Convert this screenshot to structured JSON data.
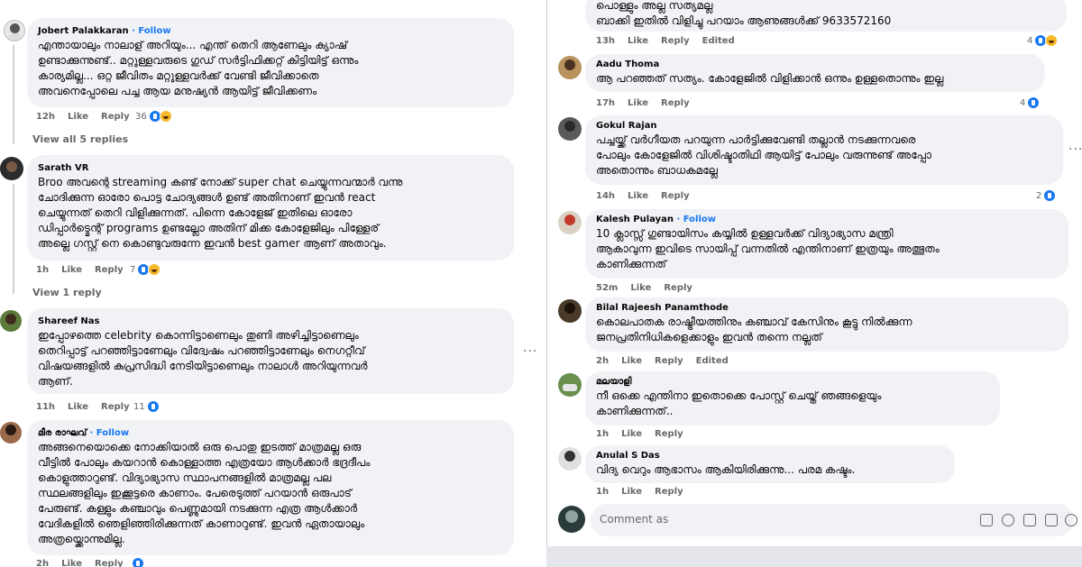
{
  "left": {
    "comments": [
      {
        "name": "Jobert Palakkaran",
        "follow": "· Follow",
        "text": "എന്തായാലും നാലാള് അറിയും... എന്ത് തെറി ആണേലും ക്യാഷ്\nഉണ്ടാക്കുന്നുണ്ട്.. മറ്റുള്ളവരുടെ ഗുഡ് സർട്ടിഫിക്കറ്റ് കിട്ടിയിട്ട് ഒന്നും\nകാര്യമില്ല... ഒറ്റ ജീവിതം മറ്റുള്ളവർക്ക് വേണ്ടി ജീവിക്കാതെ\nഅവനെപ്പോലെ പച്ച ആയ മനുഷ്യൻ ആയിട്ട് ജീവിക്കണം",
        "time": "12h",
        "like": "Like",
        "reply": "Reply",
        "count": "36"
      },
      {
        "name": "Sarath VR",
        "follow": "",
        "text": "Broo അവന്റെ streaming കണ്ട് നോക്ക് super chat ചെയ്യുന്നവന്മാർ വന്നു\nചോദിക്കുന്ന ഓരോ പൊട്ട ചോദ്യങ്ങൾ ഉണ്ട് അതിനാണ് ഇവൻ react\nചെയ്യുന്നത് തെറി വിളിക്കുന്നത്. പിന്നെ കോളേജ് ഇതിലെ ഓരോ\nഡിപ്പാർട്മെന്റ് programs ഉണ്ടല്ലോ അതിന് മിക്ക കോളേജിലും പിള്ളേര്\nഅല്ലെ ഗസ്റ്റ് നെ കൊണ്ടുവരുന്നേ ഇവൻ best gamer ആണ് അതാവും.",
        "time": "1h",
        "like": "Like",
        "reply": "Reply",
        "count": "7"
      },
      {
        "name": "Shareef Nas",
        "follow": "",
        "text": "ഇപ്പോഴത്തെ celebrity കൊന്നിട്ടാണെലും തുണി അഴിച്ചിട്ടാണെലും\nതെറിപ്പാട്ട് പറഞ്ഞിട്ടാണേലും വിദ്വേഷം പറഞ്ഞിട്ടാണേലും നെഗറ്റീവ്\nവിഷയങ്ങളിൽ കുപ്രസിദ്ധി നേടിയിട്ടാണെലും നാലാൾ അറിയുന്നവർ\nആണ്.",
        "time": "11h",
        "like": "Like",
        "reply": "Reply",
        "count": "11"
      },
      {
        "name": "മീര രാഘവ്",
        "follow": "· Follow",
        "text": "അങ്ങനെയൊക്കെ നോക്കിയാൽ ഒരു പൊതു ഇടത്ത് മാത്രമല്ല ഒരു\nവീട്ടിൽ പോലും കയറാൻ കൊള്ളാത്ത എത്രയോ ആൾക്കാർ ഭദ്രദീപം\nകൊളുത്താറുണ്ട്. വിദ്യാഭ്യാസ സ്ഥാപനങ്ങളിൽ മാത്രമല്ല പല\nസ്ഥലങ്ങളിലും ഇക്കൂട്ടരെ കാണാം. പേരെടുത്ത് പറയാൻ ഒരുപാട്\nപേരുണ്ട്. കള്ളും കഞ്ചാവും പെണ്ണുമായി നടക്കുന്ന എത്ര ആൾക്കാർ\nവേദികളിൽ ഞെളിഞ്ഞിരിക്കുന്നത് കാണാറുണ്ട്. ഇവൻ ഏതായാലും\nഅത്രയ്ക്കൊന്നുമില്ല.",
        "time": "2h",
        "like": "Like",
        "reply": "Reply",
        "count": ""
      }
    ],
    "view_replies": [
      "View all 5 replies",
      "View 1 reply"
    ]
  },
  "right": {
    "top_text": "പൊള്ളും അല്ല സത്യമല്ല\nബാക്കി ഇതിൽ വിളിച്ചു പറയാം ആണുങ്ങൾക്ക് 9633572160",
    "top_meta": {
      "time": "13h",
      "like": "Like",
      "reply": "Reply",
      "edited": "Edited",
      "count": "4"
    },
    "comments": [
      {
        "name": "Aadu Thoma",
        "follow": "",
        "text": "ആ പറഞ്ഞത് സത്യം. കോളേജിൽ വിളിക്കാൻ ഒന്നും ഉള്ളതൊന്നും ഇല്ല",
        "time": "17h",
        "like": "Like",
        "reply": "Reply",
        "edited": "",
        "count": "4"
      },
      {
        "name": "Gokul Rajan",
        "follow": "",
        "text": "പച്ചയ്ക്ക് വർഗീയത പറയുന്ന പാർട്ടിക്കുവേണ്ടി തല്ലാൻ നടക്കുന്നവരെ\nപോലും കോളേജിൽ വിശിഷ്ടാതിഥി ആയിട്ട് പോലും വരുന്നുണ്ട് അപ്പോ\nഅതൊന്നും ബാധകമല്ലേ",
        "time": "14h",
        "like": "Like",
        "reply": "Reply",
        "edited": "",
        "count": "2"
      },
      {
        "name": "Kalesh Pulayan",
        "follow": "· Follow",
        "text": "10 ക്ലാസ്സ് ഗുണ്ടായിസം കയ്യിൽ ഉള്ളവർക്ക് വിദ്യാഭ്യാസ മന്ത്രി\nആകാവുന്ന ഇവിടെ സായിപ്പ് വന്നതിൽ എന്തിനാണ് ഇത്രയും അത്ഭുതം\nകാണിക്കുന്നത്",
        "time": "52m",
        "like": "Like",
        "reply": "Reply",
        "edited": "",
        "count": ""
      },
      {
        "name": "Bilal Rajeesh Panamthode",
        "follow": "",
        "text": "കൊലപാതക രാഷ്ട്രീയത്തിനും കഞ്ചാവ് കേസിനും കൂട്ടു നിൽക്കുന്ന\nജനപ്രതിനിധികളെക്കാളും ഇവൻ തന്നെ നല്ലത്",
        "time": "2h",
        "like": "Like",
        "reply": "Reply",
        "edited": "Edited",
        "count": ""
      },
      {
        "name": "മലയാളി",
        "follow": "",
        "text": "നീ ഒക്കെ എന്തിനാ ഇതൊക്കെ പോസ്റ്റ് ചെയ്ത് ഞങ്ങളെയും\nകാണിക്കുന്നത്..",
        "time": "1h",
        "like": "Like",
        "reply": "Reply",
        "edited": "",
        "count": ""
      },
      {
        "name": "Anulal S Das",
        "follow": "",
        "text": "വിദ്യ വെറും ആഭാസം ആകിയിരിക്കുന്നു... പരമ കഷ്ടം.",
        "time": "1h",
        "like": "Like",
        "reply": "Reply",
        "edited": "",
        "count": ""
      }
    ],
    "comment_placeholder": "Comment as"
  },
  "colors": {
    "accent": "#1877f2",
    "bubble": "#f0f2f5",
    "meta": "#65676b"
  },
  "icons": [
    "like-reaction-icon",
    "haha-reaction-icon",
    "more-options-icon",
    "sticker-icon",
    "emoji-icon",
    "camera-icon",
    "gif-icon",
    "avatar-sticker-icon"
  ]
}
